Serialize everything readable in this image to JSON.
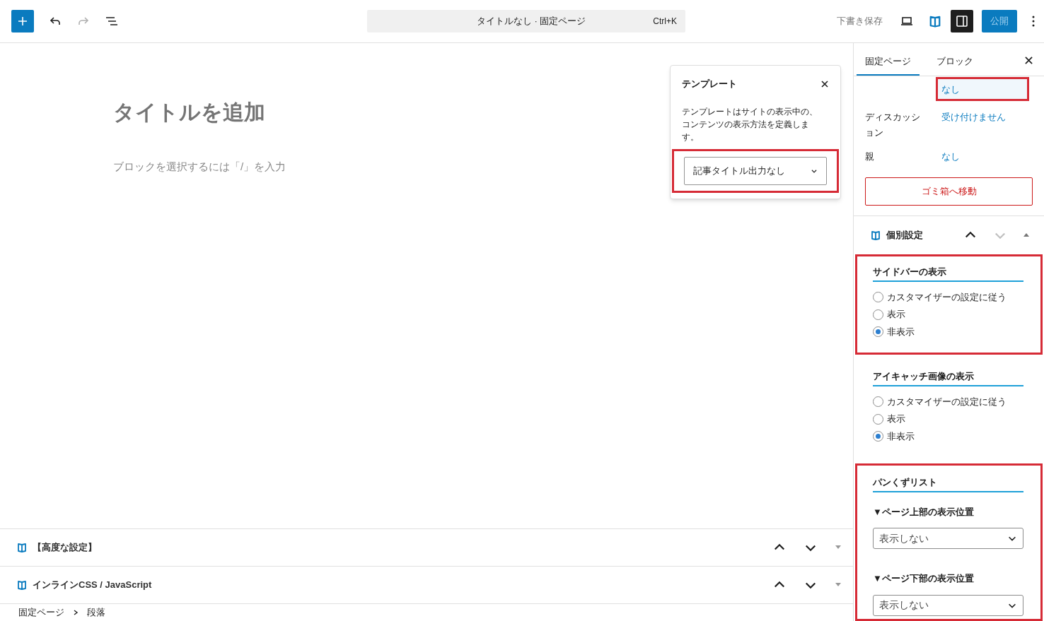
{
  "toolbar": {
    "redo": {
      "disabled": true
    },
    "command_bar": {
      "title": "タイトルなし · 固定ページ",
      "shortcut": "Ctrl+K"
    },
    "save_draft": "下書き保存",
    "settings_pressed": true,
    "publish": "公開"
  },
  "editor": {
    "title_placeholder": "タイトルを追加",
    "block_placeholder": "ブロックを選択するには「/」を入力"
  },
  "template_popover": {
    "title": "テンプレート",
    "description": "テンプレートはサイトの表示中の、コンテンツの表示方法を定義します。",
    "value": "記事タイトル出力なし",
    "highlighted": true
  },
  "sidebar": {
    "tabs": [
      {
        "label": "固定ページ",
        "selected": true
      },
      {
        "label": "ブロック",
        "selected": false
      }
    ],
    "rows": [
      {
        "value": "なし",
        "highlighted": true
      },
      {
        "label": "ディスカッション",
        "value": "受け付けません",
        "highlighted": false
      },
      {
        "label": "親",
        "value": "なし",
        "highlighted": false
      }
    ],
    "trash_button": "ゴミ箱へ移動",
    "panel": {
      "title": "個別設定",
      "expanded": true,
      "move_down_disabled": true
    },
    "sections": [
      {
        "kind": "radio",
        "title": "サイドバーの表示",
        "highlighted": true,
        "options": [
          {
            "label": "カスタマイザーの設定に従う",
            "selected": false
          },
          {
            "label": "表示",
            "selected": false
          },
          {
            "label": "非表示",
            "selected": true
          }
        ]
      },
      {
        "kind": "radio",
        "title": "アイキャッチ画像の表示",
        "highlighted": false,
        "options": [
          {
            "label": "カスタマイザーの設定に従う",
            "selected": false
          },
          {
            "label": "表示",
            "selected": false
          },
          {
            "label": "非表示",
            "selected": true
          }
        ]
      },
      {
        "kind": "selects",
        "title": "パンくずリスト",
        "highlighted": true,
        "fields": [
          {
            "label": "▼ページ上部の表示位置",
            "value": "表示しない"
          },
          {
            "label": "▼ページ下部の表示位置",
            "value": "表示しない"
          }
        ]
      }
    ]
  },
  "metaboxes": [
    {
      "title": "【高度な設定】"
    },
    {
      "title": "インラインCSS / JavaScript"
    }
  ],
  "breadcrumb": [
    "固定ページ",
    "段落"
  ]
}
